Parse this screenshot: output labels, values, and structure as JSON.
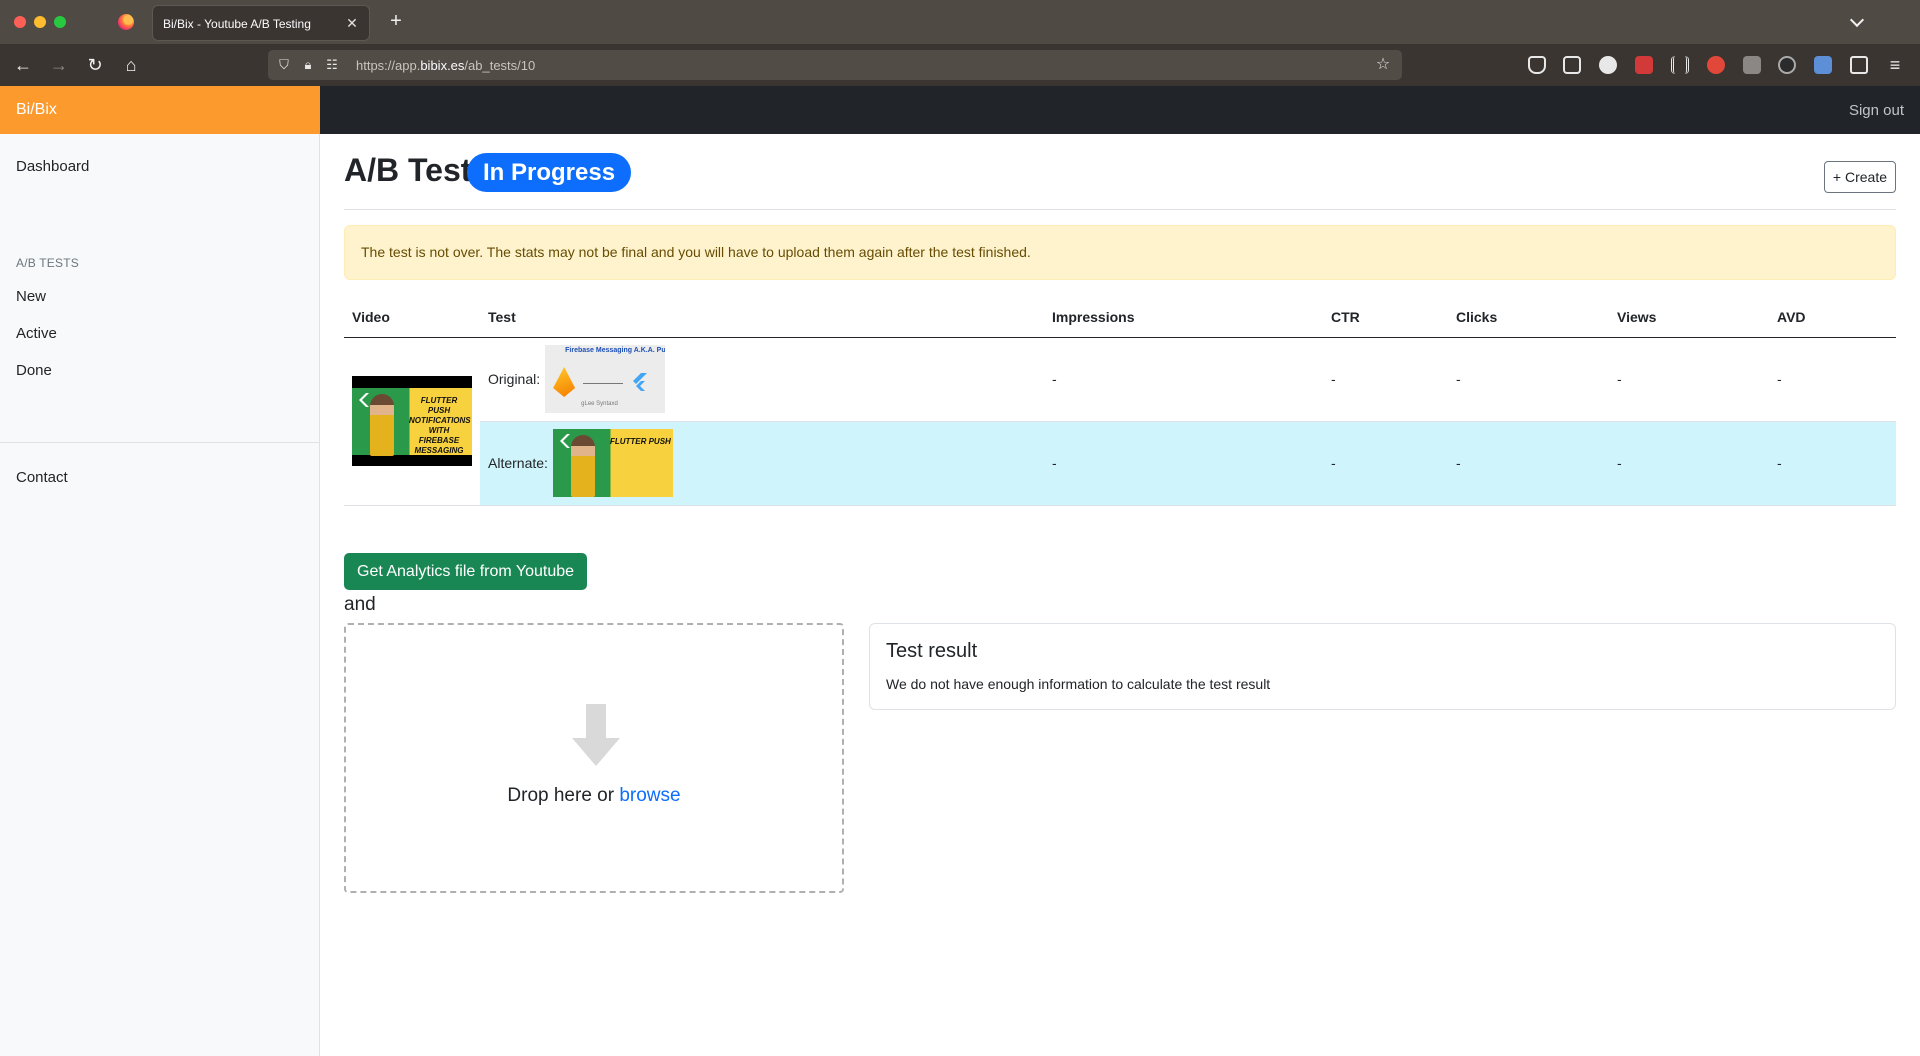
{
  "browser": {
    "tab_title": "Bi/Bix - Youtube A/B Testing",
    "url_prefix": "https://app.",
    "url_domain": "bibix.es",
    "url_path": "/ab_tests/10"
  },
  "app": {
    "brand": "Bi/Bix",
    "sign_out": "Sign out"
  },
  "sidebar": {
    "dashboard": "Dashboard",
    "section_heading": "A/B TESTS",
    "items": [
      {
        "label": "New"
      },
      {
        "label": "Active"
      },
      {
        "label": "Done"
      }
    ],
    "contact": "Contact"
  },
  "page": {
    "title": "A/B Test",
    "status": "In Progress",
    "create_label": "+ Create",
    "alert": "The test is not over. The stats may not be final and you will have to upload them again after the test finished."
  },
  "table": {
    "headers": [
      "Video",
      "Test",
      "Impressions",
      "CTR",
      "Clicks",
      "Views",
      "AVD"
    ],
    "rows": [
      {
        "variant": "Original:",
        "impressions": "-",
        "ctr": "-",
        "clicks": "-",
        "views": "-",
        "avd": "-"
      },
      {
        "variant": "Alternate:",
        "impressions": "-",
        "ctr": "-",
        "clicks": "-",
        "views": "-",
        "avd": "-"
      }
    ]
  },
  "thumbnails": {
    "flutter_caption": "FLUTTER PUSH NOTIFICATIONS WITH FIREBASE MESSAGING",
    "original_title": "Firebase Messaging A.K.A. Push Notification",
    "original_author": "gLee Syntaxd"
  },
  "analytics_button": "Get Analytics file from Youtube",
  "and_text": "and",
  "dropzone": {
    "prefix": "Drop here or ",
    "link": "browse"
  },
  "result": {
    "title": "Test result",
    "text": "We do not have enough information to calculate the test result"
  },
  "colors": {
    "brand": "#fd9a2d",
    "status_badge": "#0d6efd",
    "analytics_button": "#198754",
    "alert_bg": "#fff3cd",
    "highlight_row": "#cff4fc"
  }
}
